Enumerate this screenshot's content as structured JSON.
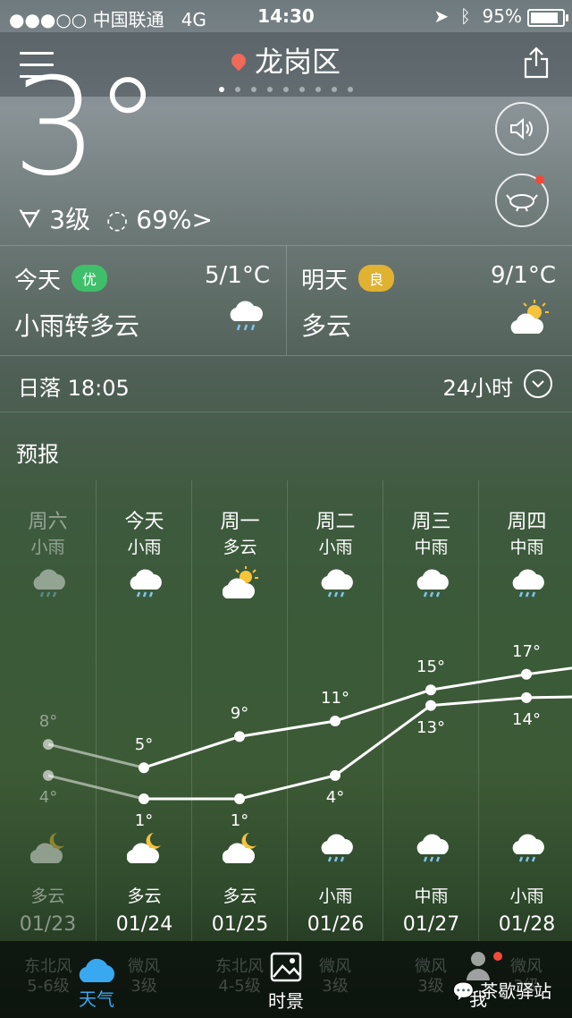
{
  "status": {
    "carrier": "●●●○○ 中国联通",
    "network": "4G",
    "time": "14:30",
    "battery": "95%",
    "battery_fraction": 0.95
  },
  "header": {
    "city": "龙岗区",
    "page_count": 9,
    "active_page": 0
  },
  "current": {
    "temp": "3°",
    "wind": "3级",
    "humidity": "69%"
  },
  "today_card": {
    "name": "今天",
    "aqi": "优",
    "aqi_color": "#3fbf6a",
    "hl": "5/1°C",
    "cond": "小雨转多云"
  },
  "tomorrow_card": {
    "name": "明天",
    "aqi": "良",
    "aqi_color": "#e0b232",
    "hl": "9/1°C",
    "cond": "多云"
  },
  "sunset": {
    "label": "日落 18:05",
    "toggle": "24小时"
  },
  "forecast": {
    "title": "预报",
    "days": [
      {
        "day": "周六",
        "cond": "小雨",
        "high": 8,
        "low": 4,
        "night": "多云",
        "date": "01/23",
        "icon": "rain-cloud-icon",
        "nicon": "moon-cloud-icon"
      },
      {
        "day": "今天",
        "cond": "小雨",
        "high": 5,
        "low": 1,
        "night": "多云",
        "date": "01/24",
        "icon": "rain-cloud-icon",
        "nicon": "moon-cloud-icon"
      },
      {
        "day": "周一",
        "cond": "多云",
        "high": 9,
        "low": 1,
        "night": "多云",
        "date": "01/25",
        "icon": "sun-cloud-icon",
        "nicon": "moon-cloud-icon"
      },
      {
        "day": "周二",
        "cond": "小雨",
        "high": 11,
        "low": 4,
        "night": "小雨",
        "date": "01/26",
        "icon": "rain-cloud-icon",
        "nicon": "rain-cloud-icon"
      },
      {
        "day": "周三",
        "cond": "中雨",
        "high": 15,
        "low": 13,
        "night": "中雨",
        "date": "01/27",
        "icon": "rain-cloud-icon",
        "nicon": "rain-cloud-icon"
      },
      {
        "day": "周四",
        "cond": "中雨",
        "high": 17,
        "low": 14,
        "night": "小雨",
        "date": "01/28",
        "icon": "rain-cloud-icon",
        "nicon": "rain-cloud-icon"
      }
    ],
    "labels": {
      "h0": "8°",
      "l0": "4°",
      "h1": "5°",
      "l1": "1°",
      "h2": "9°",
      "l2": "1°",
      "h3": "11°",
      "l3": "4°",
      "h4": "15°",
      "l4": "13°",
      "h5": "17°",
      "l5": "14°"
    }
  },
  "tabbar": {
    "weather": "天气",
    "scenery": "时景",
    "me": "我",
    "bg_wind": [
      [
        "东北风",
        "5-6级"
      ],
      [
        "微风",
        "3级"
      ],
      [
        "东北风",
        "4-5级"
      ],
      [
        "微风",
        "3级"
      ],
      [
        "微风",
        "3级"
      ],
      [
        "微风",
        "3级"
      ]
    ],
    "watermark": "茶歇驿站"
  }
}
